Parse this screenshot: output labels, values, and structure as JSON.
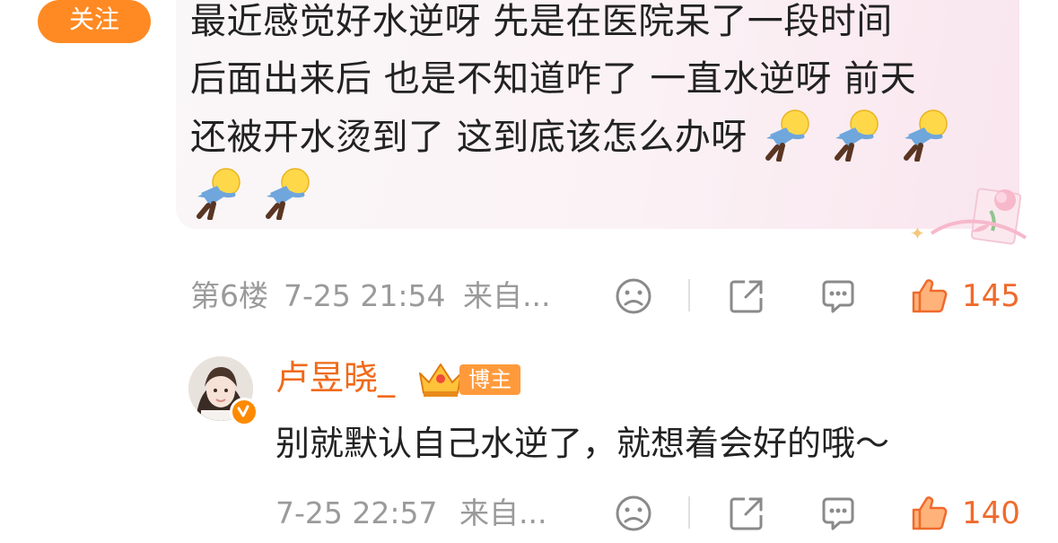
{
  "follow": {
    "label": "关注"
  },
  "comment": {
    "text_line1": "最近感觉好水逆呀 先是在医院呆了一段时间",
    "text_line2": "后面出来后 也是不知道咋了 一直水逆呀 前天",
    "text_line3": "还被开水烫到了 这到底该怎么办呀",
    "emoji_name": "sweating-doll-emoji",
    "meta": {
      "floor": "第6楼",
      "time": "7-25 21:54",
      "source": "来自...",
      "likes": "145"
    }
  },
  "reply": {
    "author": "卢昱晓_",
    "badge": "博主",
    "text": "别就默认自己水逆了，就想着会好的哦～",
    "meta": {
      "time": "7-25 22:57",
      "source": "来自...",
      "likes": "140"
    }
  },
  "colors": {
    "accent": "#ff8a24",
    "like": "#ef6a2c",
    "author": "#f06a1a",
    "meta": "#9a9a9a"
  },
  "icons": [
    "dislike-face-icon",
    "share-icon",
    "comment-icon",
    "thumbs-up-icon"
  ]
}
